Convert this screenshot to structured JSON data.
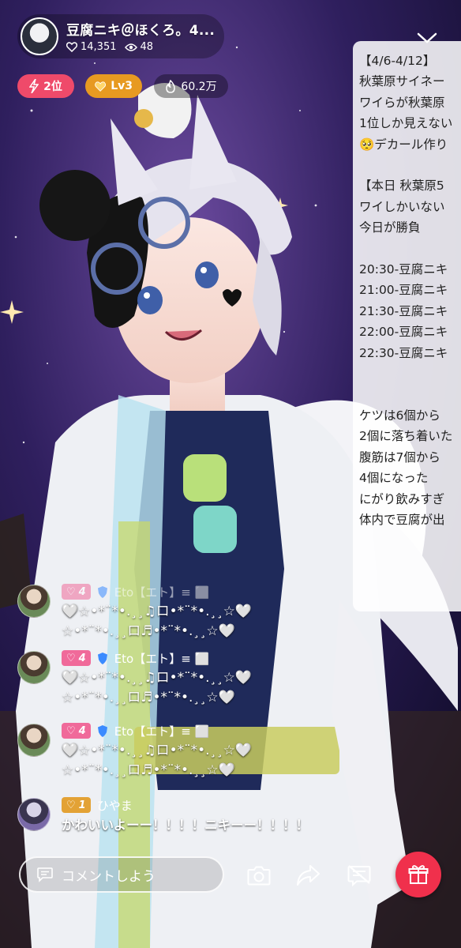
{
  "header": {
    "streamer_name": "豆腐ニキ＠ほくろ。4...",
    "likes": "14,351",
    "viewers": "48"
  },
  "badges": {
    "rank": "2位",
    "level": "Lv3",
    "points": "60.2万"
  },
  "notice": {
    "lines": [
      "【4/6-4/12】",
      "秋葉原サイネー",
      "ワイらが秋葉原",
      "1位しか見えない",
      "🥺デカール作り",
      "",
      "【本日 秋葉原5",
      "ワイしかいない",
      "今日が勝負",
      "",
      "20:30-豆腐ニキ",
      "21:00-豆腐ニキ",
      "21:30-豆腐ニキ",
      "22:00-豆腐ニキ",
      "22:30-豆腐ニキ",
      "",
      "",
      "ケツは6個から",
      "2個に落ち着いた",
      "腹筋は7個から",
      "4個になった",
      "にがり飲みすぎ",
      "体内で豆腐が出"
    ]
  },
  "chat": [
    {
      "user": "Eto【エト】≡ ⬜",
      "level": "4",
      "line1": "🤍☆•*¨*•.¸¸♫ロ•*¨*•.¸¸☆🤍",
      "line2": "☆•*¨*•.¸¸ロ♬•*¨*•.¸¸☆🤍"
    },
    {
      "user": "Eto【エト】≡ ⬜",
      "level": "4",
      "line1": "🤍☆•*¨*•.¸¸♫ロ•*¨*•.¸¸☆🤍",
      "line2": "☆•*¨*•.¸¸ロ♬•*¨*•.¸¸☆🤍"
    },
    {
      "user": "Eto【エト】≡ ⬜",
      "level": "4",
      "line1": "🤍☆•*¨*•.¸¸♫ロ•*¨*•.¸¸☆🤍",
      "line2": "☆•*¨*•.¸¸ロ♬•*¨*•.¸¸☆🤍"
    },
    {
      "user": "ひやま",
      "level": "1",
      "line1": "かわいいよーー！！！！ニキーー！！！！"
    }
  ],
  "bottom": {
    "comment_placeholder": "コメントしよう"
  },
  "colors": {
    "rank_badge": "#ef4a6a",
    "level_badge": "#e79a21",
    "gift_button": "#f0304c",
    "fan_pink": "#f06a9a",
    "fan_gold": "#e3a235"
  },
  "icons": [
    "heart-outline-icon",
    "eye-icon",
    "bolt-icon",
    "heart-level-icon",
    "fire-icon",
    "chevron-down-icon",
    "comment-icon",
    "camera-icon",
    "share-icon",
    "caption-off-icon",
    "gift-icon",
    "shield-icon"
  ]
}
